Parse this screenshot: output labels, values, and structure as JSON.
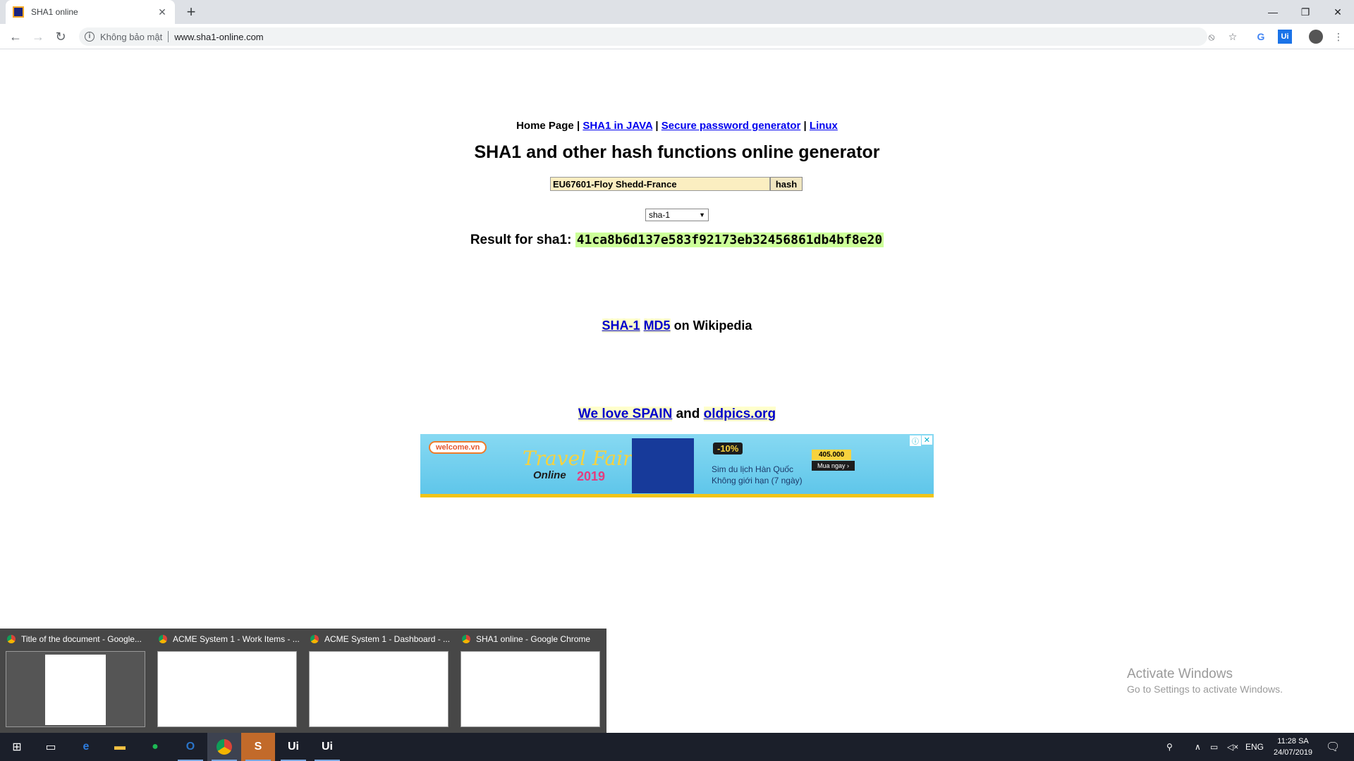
{
  "browser": {
    "tab_title": "SHA1 online",
    "security_text": "Không bảo mật",
    "url": "www.sha1-online.com"
  },
  "page": {
    "nav_home": "Home Page",
    "nav_sep": "|",
    "nav_java": "SHA1 in JAVA",
    "nav_password": "Secure password generator",
    "nav_linux": "Linux",
    "heading": "SHA1 and other hash functions online generator",
    "input_value": "EU67601-Floy Shedd-France",
    "hash_button": "hash",
    "algorithm_selected": "sha-1",
    "result_label": "Result for sha1:",
    "result_hash": "41ca8b6d137e583f92173eb32456861db4bf8e20",
    "wiki_sha1": "SHA-1",
    "wiki_md5": "MD5",
    "wiki_suffix": "on Wikipedia",
    "love_spain": "We love SPAIN",
    "love_and": "and",
    "love_oldpics": "oldpics.org"
  },
  "ad": {
    "welcome": "welcome.vn",
    "travel": "Travel Fair",
    "online": "Online",
    "year": "2019",
    "badge": "-10%",
    "line1": "Sim du lịch Hàn Quốc",
    "line2": "Không giới hạn (7 ngày)",
    "price": "405.000",
    "buy": "Mua ngay ›"
  },
  "taskbar_previews": [
    {
      "title": "Title of the document - Google..."
    },
    {
      "title": "ACME System 1 - Work Items - ..."
    },
    {
      "title": "ACME System 1 - Dashboard - ..."
    },
    {
      "title": "SHA1 online - Google Chrome"
    }
  ],
  "watermark": {
    "line1": "Activate Windows",
    "line2": "Go to Settings to activate Windows."
  },
  "tray": {
    "lang": "ENG",
    "time": "11:28 SA",
    "date": "24/07/2019"
  }
}
